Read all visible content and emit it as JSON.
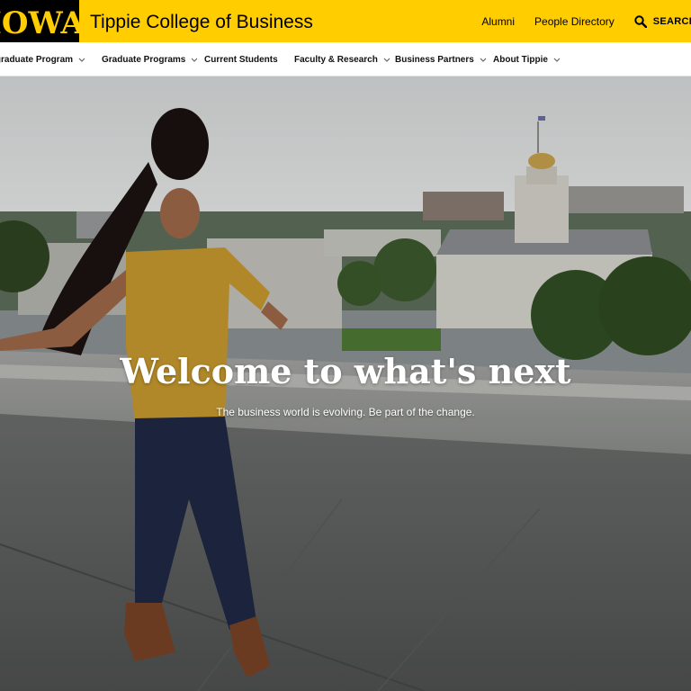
{
  "header": {
    "logo_text": "IOWA",
    "college_name": "Tippie College of Business",
    "utility_links": [
      "Alumni",
      "People Directory"
    ],
    "search_label": "SEARCH"
  },
  "nav": {
    "items": [
      {
        "label": "Undergraduate Program",
        "has_dropdown": true
      },
      {
        "label": "Graduate Programs",
        "has_dropdown": true
      },
      {
        "label": "Current Students",
        "has_dropdown": false
      },
      {
        "label": "Faculty & Research",
        "has_dropdown": true
      },
      {
        "label": "Business Partners",
        "has_dropdown": true
      },
      {
        "label": "About Tippie",
        "has_dropdown": true
      }
    ]
  },
  "hero": {
    "title": "Welcome to what's next",
    "subtitle": "The business world is evolving. Be part of the change."
  },
  "colors": {
    "brand_gold": "#FFCD00",
    "brand_black": "#000000"
  }
}
